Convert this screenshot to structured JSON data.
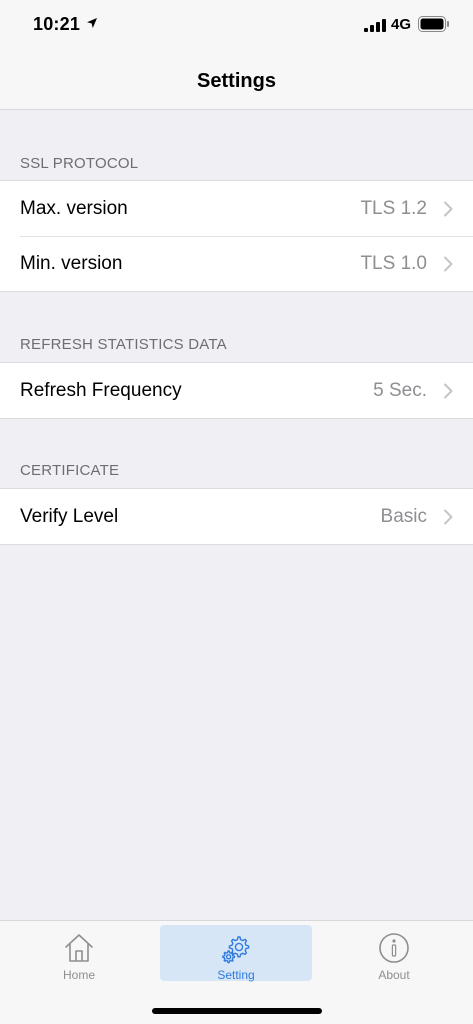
{
  "status_bar": {
    "time": "10:21",
    "network": "4G"
  },
  "nav": {
    "title": "Settings"
  },
  "sections": [
    {
      "header": "SSL PROTOCOL",
      "rows": [
        {
          "label": "Max. version",
          "value": "TLS 1.2"
        },
        {
          "label": "Min. version",
          "value": "TLS 1.0"
        }
      ]
    },
    {
      "header": "REFRESH STATISTICS DATA",
      "rows": [
        {
          "label": "Refresh Frequency",
          "value": "5 Sec."
        }
      ]
    },
    {
      "header": "CERTIFICATE",
      "rows": [
        {
          "label": "Verify Level",
          "value": "Basic"
        }
      ]
    }
  ],
  "tabs": [
    {
      "label": "Home",
      "icon": "home-icon",
      "active": false
    },
    {
      "label": "Setting",
      "icon": "gear-icon",
      "active": true
    },
    {
      "label": "About",
      "icon": "info-icon",
      "active": false
    }
  ],
  "colors": {
    "accent": "#2f7bde",
    "active_tab_bg": "#d7e6f7",
    "background": "#efeff4",
    "secondary_text": "#8e8e93"
  }
}
